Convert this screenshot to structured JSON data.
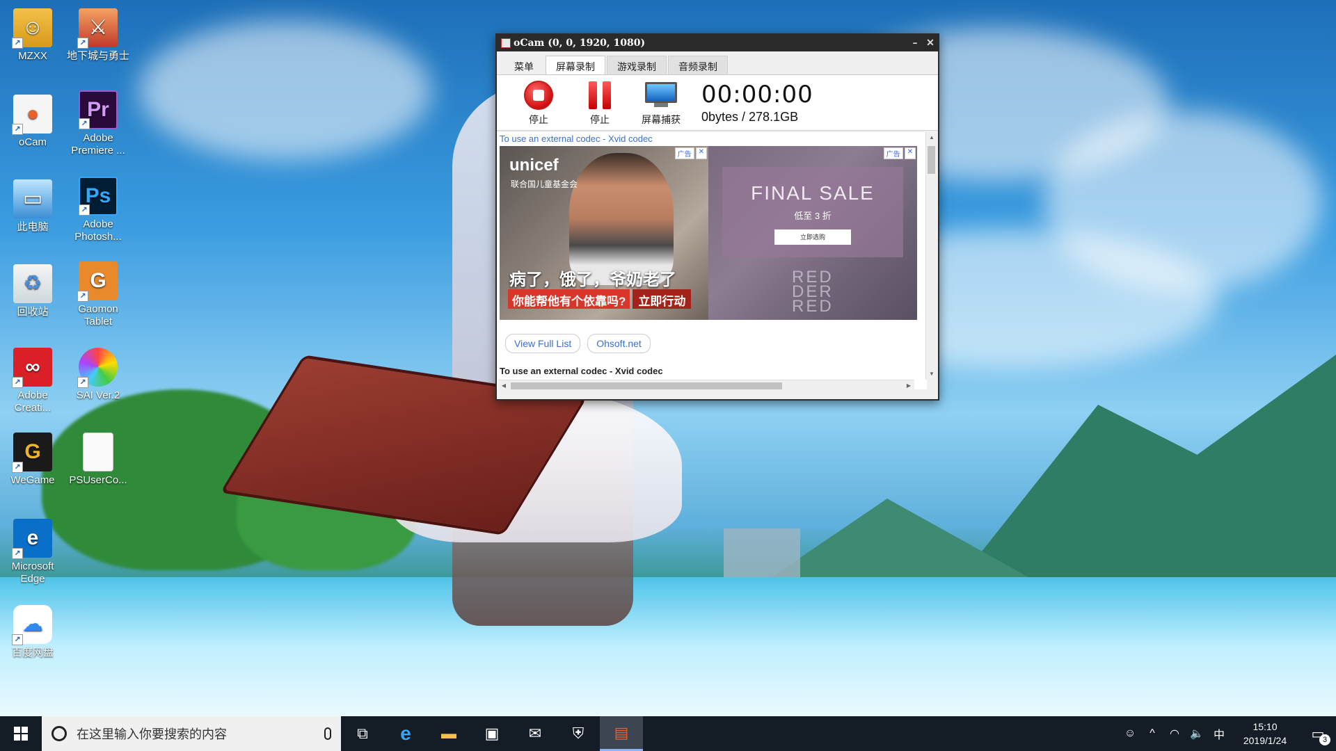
{
  "desktop": {
    "icons": [
      {
        "label": "MZXX",
        "icon": "user-folder-icon"
      },
      {
        "label": "地下城与勇士",
        "icon": "dnf-game-icon"
      },
      {
        "label": "oCam",
        "icon": "ocam-icon"
      },
      {
        "label": "Adobe Premiere ...",
        "icon": "premiere-icon",
        "glyph": "Pr"
      },
      {
        "label": "此电脑",
        "icon": "computer-icon"
      },
      {
        "label": "Adobe Photosh...",
        "icon": "photoshop-icon",
        "glyph": "Ps"
      },
      {
        "label": "回收站",
        "icon": "recycle-bin-icon"
      },
      {
        "label": "Gaomon Tablet",
        "icon": "gaomon-icon"
      },
      {
        "label": "Adobe Creati...",
        "icon": "creative-cloud-icon"
      },
      {
        "label": "SAI Ver.2",
        "icon": "sai-icon"
      },
      {
        "label": "WeGame",
        "icon": "wegame-icon"
      },
      {
        "label": "PSUserCo...",
        "icon": "file-icon"
      },
      {
        "label": "Microsoft Edge",
        "icon": "edge-icon",
        "glyph": "e"
      },
      {
        "label": "百度网盘",
        "icon": "baidu-netdisk-icon"
      }
    ]
  },
  "ocam": {
    "title": "oCam (0, 0, 1920, 1080)",
    "minimize": "–",
    "close": "✕",
    "tabs": [
      "菜单",
      "屏幕录制",
      "游戏录制",
      "音频录制"
    ],
    "active_tab": "屏幕录制",
    "tools": {
      "stop_label": "停止",
      "pause_label": "停止",
      "capture_label": "屏幕捕获"
    },
    "timer": "00:00:00",
    "size_info": "0bytes / 278.1GB",
    "codec_link": "To use an external codec - Xvid codec",
    "ad1": {
      "brand": "unicef",
      "brand_sub": "联合国儿童基金会",
      "headline": "病了，饿了，爷奶老了",
      "question": "你能帮他有个依靠吗?",
      "cta": "立即行动",
      "ad_mark": "广告",
      "close": "✕"
    },
    "ad2": {
      "sale": "FINAL SALE",
      "sale_sub": "低至 3 折",
      "btn": "立即选购",
      "big": "RED\nDER\nRED",
      "ad_mark": "广告",
      "close": "✕"
    },
    "links": [
      "View Full List",
      "Ohsoft.net"
    ],
    "codec_bold": "To use an external codec - Xvid codec"
  },
  "taskbar": {
    "search_placeholder": "在这里输入你要搜索的内容",
    "apps": [
      {
        "name": "task-view-icon",
        "glyph": "⧉"
      },
      {
        "name": "edge-taskbar-icon",
        "glyph": "e"
      },
      {
        "name": "file-explorer-icon",
        "glyph": "▬"
      },
      {
        "name": "store-icon",
        "glyph": "▣"
      },
      {
        "name": "mail-icon",
        "glyph": "✉"
      },
      {
        "name": "security-shield-icon",
        "glyph": "⛨"
      },
      {
        "name": "ocam-taskbar-icon",
        "glyph": "▤"
      }
    ],
    "tray": {
      "people": "☺",
      "chevron": "^",
      "network": "◠",
      "volume": "🔈",
      "ime": "中"
    },
    "time": "15:10",
    "date": "2019/1/24",
    "notifications": "3"
  }
}
